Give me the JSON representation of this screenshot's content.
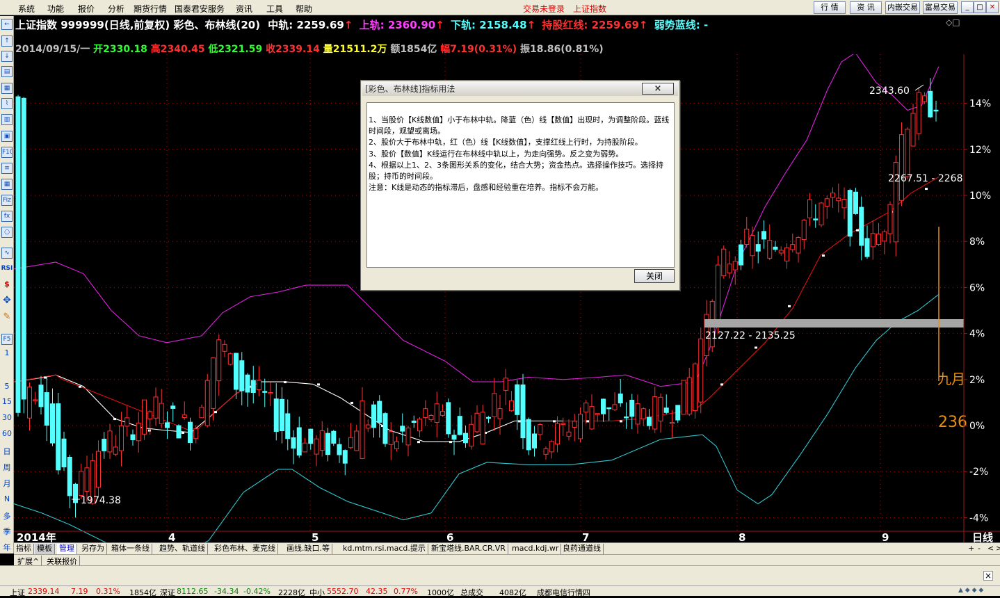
{
  "menu": [
    "系统",
    "功能",
    "报价",
    "分析",
    "期货行情",
    "国泰君安服务",
    "资讯",
    "工具",
    "帮助"
  ],
  "status": {
    "trade": "交易未登录",
    "index": "上证指数"
  },
  "top_buttons": [
    "行 情",
    "资 讯",
    "内嵌交易",
    "富易交易"
  ],
  "toolbar_text": [
    "RSI",
    "1",
    "5",
    "15",
    "30",
    "60",
    "日",
    "周",
    "月",
    "N",
    "多",
    "季",
    "年"
  ],
  "header": {
    "name": "上证指数 999999(日线,前复权) 彩色、布林线(20)",
    "mid_label": "中轨: 2259.69",
    "upper_label": "上轨: 2360.90",
    "lower_label": "下轨: 2158.48",
    "hold_label": "持股红线: 2259.69",
    "weak_label": "弱势蓝线: -",
    "date": "2014/09/15/一",
    "open": "开2330.18",
    "high": "高2340.45",
    "low": "低2321.59",
    "close": "收2339.14",
    "vol": "量21511.2万",
    "amount": "额1854亿",
    "change": "幅7.19(0.31%)",
    "amp": "振18.86(0.81%)"
  },
  "chart_data": {
    "type": "candlestick",
    "y_axis_ticks": [
      "14%",
      "12%",
      "10%",
      "8%",
      "6%",
      "4%",
      "2%",
      "0%",
      "-2%",
      "-4%"
    ],
    "x_axis_ticks": [
      "2014年",
      "4",
      "5",
      "6",
      "7",
      "8",
      "9"
    ],
    "x_axis_right": "日线",
    "ylim_pct": [
      -4.3,
      15.2
    ],
    "annotations": {
      "high": "2343.60",
      "low": "1974.38",
      "range1": "2267.51 - 2268",
      "range2": "2127.22 - 2135.25",
      "side_text": "九月",
      "side_value": "236"
    },
    "colors": {
      "up": "#ff3030",
      "down": "#54ffff",
      "upper": "#e020e0",
      "lower": "#30c8d0",
      "mid_red": "#e01010",
      "mid_white": "#ffffff",
      "grid": "#a01818",
      "orange": "#e69010"
    }
  },
  "tabs": [
    "指标",
    "模板",
    "管理",
    "另存为",
    "箱体一条线",
    "趋势、轨道线",
    "彩色布林、麦克线",
    "画线.缺口.等",
    "kd.mtm.rsi.macd.提示",
    "新宝塔线.BAR.CR.VR",
    "macd.kdj.wr",
    "良药通道线"
  ],
  "row2": [
    "扩展^",
    "关联报价"
  ],
  "tab_right": [
    "+",
    "-",
    "<",
    ">"
  ],
  "statusbar": {
    "sh_label": "上证",
    "sh_value": "2339.14",
    "sh_chg": "7.19",
    "sh_pct": "0.31%",
    "sh_amt": "1854亿",
    "sz_label": "深证",
    "sz_value": "8112.65",
    "sz_chg": "-34.34",
    "sz_pct": "-0.42%",
    "sz_amt": "2228亿",
    "zx_label": "中小",
    "zx_value": "5552.70",
    "zx_chg": "42.35",
    "zx_pct": "0.77%",
    "zx_amt": "1000亿",
    "total_label": "总成交",
    "total": "4082亿",
    "news": "成都电信行情四"
  },
  "dialog": {
    "title": "[彩色、布林线]指标用法",
    "close_x": "×",
    "body": "1、当股价【K线数值】小于布林中轨。降蓝（色）线【数值】出现时，为调整阶段。蓝线时间段，观望或离场。\n2、股价大于布林中轨，红（色）线【K线数值】，支撑红线上行时，为持股阶段。\n3、股价【数值】K线运行在布林线中轨以上，为走向强势。反之变为弱势。\n4、根据以上1、2、3条图形关系的变化，结合大势；资金热点。选择操作技巧。选择持股；持币的时间段。\n注意：K线是动态的指标滞后，盘感和经验重在培养。指标不会万能。",
    "ok": "关闭"
  }
}
